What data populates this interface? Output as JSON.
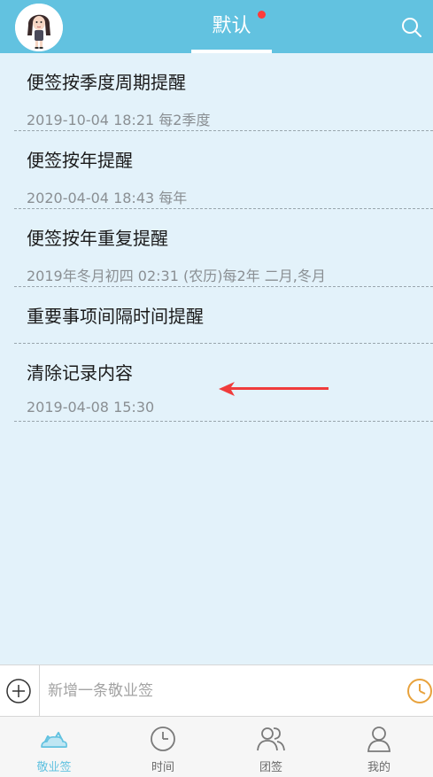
{
  "header": {
    "title": "默认",
    "has_notification_dot": true,
    "icons": {
      "avatar": "avatar-girl",
      "search": "search-icon"
    }
  },
  "items": [
    {
      "title": "便签按季度周期提醒",
      "subtitle": "2019-10-04 18:21 每2季度"
    },
    {
      "title": "便签按年提醒",
      "subtitle": "2020-04-04 18:43 每年"
    },
    {
      "title": "便签按年重复提醒",
      "subtitle": "2019年冬月初四 02:31 (农历)每2年 二月,冬月"
    },
    {
      "title": "重要事项间隔时间提醒",
      "subtitle": ""
    },
    {
      "title": "清除记录内容",
      "subtitle": "2019-04-08 15:30"
    }
  ],
  "input_bar": {
    "placeholder": "新增一条敬业签",
    "icons": {
      "add": "plus-circle-icon",
      "time": "clock-icon"
    }
  },
  "bottom_nav": [
    {
      "label": "敬业签",
      "icon": "cloud-home-icon",
      "active": true
    },
    {
      "label": "时间",
      "icon": "clock-icon",
      "active": false
    },
    {
      "label": "团签",
      "icon": "group-icon",
      "active": false
    },
    {
      "label": "我的",
      "icon": "user-icon",
      "active": false
    }
  ],
  "colors": {
    "accent": "#62c2e0",
    "background": "#e3f2fa",
    "arrow": "#f03c3c",
    "clock_orange": "#e8a23c"
  }
}
